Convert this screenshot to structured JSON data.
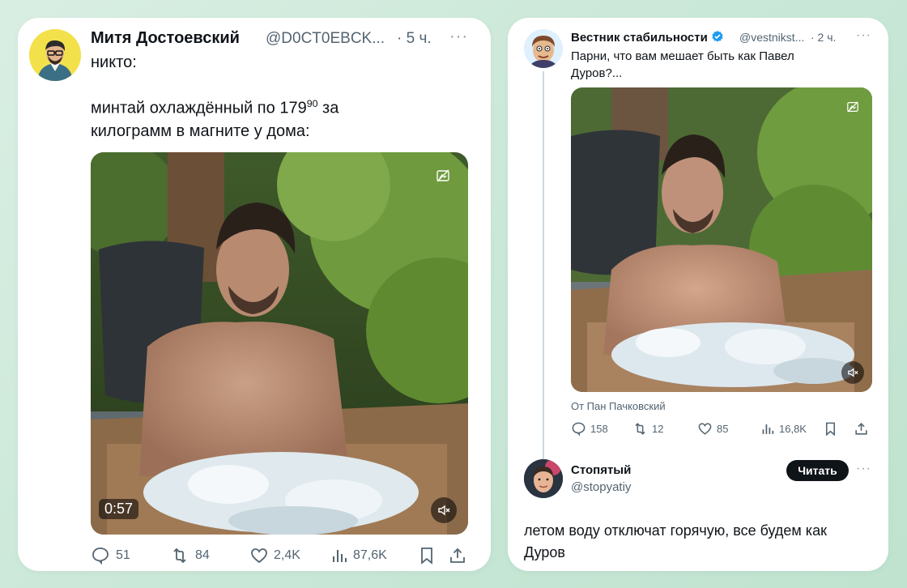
{
  "left_tweet": {
    "author_name": "Митя Достоевский",
    "author_handle": "@D0CT0EBCK...",
    "time": "· 5 ч.",
    "line1": "никто:",
    "line2_pre": "минтай охлаждённый по 179",
    "line2_sup": "90",
    "line2_post": " за",
    "line3": "килограмм в магните у дома:",
    "video_duration": "0:57",
    "stats": {
      "replies": "51",
      "retweets": "84",
      "likes": "2,4K",
      "views": "87,6K"
    }
  },
  "right_tweet": {
    "author_name": "Вестник стабильности",
    "author_handle": "@vestnikst...",
    "time": "· 2 ч.",
    "text": "Парни, что вам мешает быть как Павел Дуров?...",
    "source": "От Пан Пачковский",
    "stats": {
      "replies": "158",
      "retweets": "12",
      "likes": "85",
      "views": "16,8K"
    }
  },
  "reply": {
    "author_name": "Стопятый",
    "author_handle": "@stopyatiy",
    "follow_label": "Читать",
    "text": "летом воду отключат горячую, все будем как Дуров"
  },
  "colors": {
    "accent": "#1d9bf0",
    "text": "#0f1419",
    "muted": "#536471",
    "background": "#c9e7d6"
  }
}
